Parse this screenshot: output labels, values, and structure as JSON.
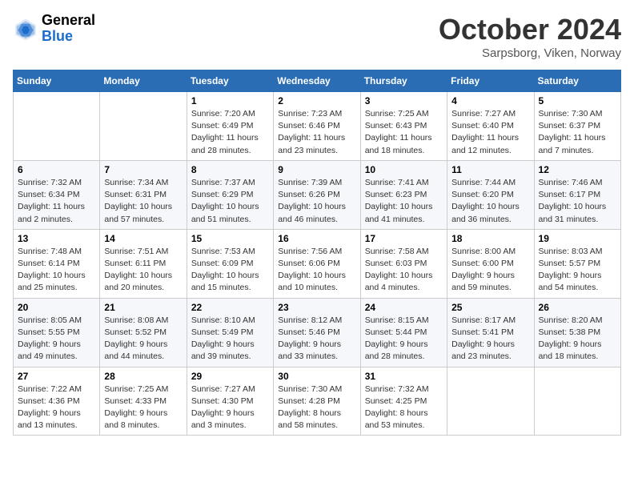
{
  "header": {
    "logo_general": "General",
    "logo_blue": "Blue",
    "month_title": "October 2024",
    "location": "Sarpsborg, Viken, Norway"
  },
  "weekdays": [
    "Sunday",
    "Monday",
    "Tuesday",
    "Wednesday",
    "Thursday",
    "Friday",
    "Saturday"
  ],
  "weeks": [
    [
      {
        "day": "",
        "info": ""
      },
      {
        "day": "",
        "info": ""
      },
      {
        "day": "1",
        "info": "Sunrise: 7:20 AM\nSunset: 6:49 PM\nDaylight: 11 hours and 28 minutes."
      },
      {
        "day": "2",
        "info": "Sunrise: 7:23 AM\nSunset: 6:46 PM\nDaylight: 11 hours and 23 minutes."
      },
      {
        "day": "3",
        "info": "Sunrise: 7:25 AM\nSunset: 6:43 PM\nDaylight: 11 hours and 18 minutes."
      },
      {
        "day": "4",
        "info": "Sunrise: 7:27 AM\nSunset: 6:40 PM\nDaylight: 11 hours and 12 minutes."
      },
      {
        "day": "5",
        "info": "Sunrise: 7:30 AM\nSunset: 6:37 PM\nDaylight: 11 hours and 7 minutes."
      }
    ],
    [
      {
        "day": "6",
        "info": "Sunrise: 7:32 AM\nSunset: 6:34 PM\nDaylight: 11 hours and 2 minutes."
      },
      {
        "day": "7",
        "info": "Sunrise: 7:34 AM\nSunset: 6:31 PM\nDaylight: 10 hours and 57 minutes."
      },
      {
        "day": "8",
        "info": "Sunrise: 7:37 AM\nSunset: 6:29 PM\nDaylight: 10 hours and 51 minutes."
      },
      {
        "day": "9",
        "info": "Sunrise: 7:39 AM\nSunset: 6:26 PM\nDaylight: 10 hours and 46 minutes."
      },
      {
        "day": "10",
        "info": "Sunrise: 7:41 AM\nSunset: 6:23 PM\nDaylight: 10 hours and 41 minutes."
      },
      {
        "day": "11",
        "info": "Sunrise: 7:44 AM\nSunset: 6:20 PM\nDaylight: 10 hours and 36 minutes."
      },
      {
        "day": "12",
        "info": "Sunrise: 7:46 AM\nSunset: 6:17 PM\nDaylight: 10 hours and 31 minutes."
      }
    ],
    [
      {
        "day": "13",
        "info": "Sunrise: 7:48 AM\nSunset: 6:14 PM\nDaylight: 10 hours and 25 minutes."
      },
      {
        "day": "14",
        "info": "Sunrise: 7:51 AM\nSunset: 6:11 PM\nDaylight: 10 hours and 20 minutes."
      },
      {
        "day": "15",
        "info": "Sunrise: 7:53 AM\nSunset: 6:09 PM\nDaylight: 10 hours and 15 minutes."
      },
      {
        "day": "16",
        "info": "Sunrise: 7:56 AM\nSunset: 6:06 PM\nDaylight: 10 hours and 10 minutes."
      },
      {
        "day": "17",
        "info": "Sunrise: 7:58 AM\nSunset: 6:03 PM\nDaylight: 10 hours and 4 minutes."
      },
      {
        "day": "18",
        "info": "Sunrise: 8:00 AM\nSunset: 6:00 PM\nDaylight: 9 hours and 59 minutes."
      },
      {
        "day": "19",
        "info": "Sunrise: 8:03 AM\nSunset: 5:57 PM\nDaylight: 9 hours and 54 minutes."
      }
    ],
    [
      {
        "day": "20",
        "info": "Sunrise: 8:05 AM\nSunset: 5:55 PM\nDaylight: 9 hours and 49 minutes."
      },
      {
        "day": "21",
        "info": "Sunrise: 8:08 AM\nSunset: 5:52 PM\nDaylight: 9 hours and 44 minutes."
      },
      {
        "day": "22",
        "info": "Sunrise: 8:10 AM\nSunset: 5:49 PM\nDaylight: 9 hours and 39 minutes."
      },
      {
        "day": "23",
        "info": "Sunrise: 8:12 AM\nSunset: 5:46 PM\nDaylight: 9 hours and 33 minutes."
      },
      {
        "day": "24",
        "info": "Sunrise: 8:15 AM\nSunset: 5:44 PM\nDaylight: 9 hours and 28 minutes."
      },
      {
        "day": "25",
        "info": "Sunrise: 8:17 AM\nSunset: 5:41 PM\nDaylight: 9 hours and 23 minutes."
      },
      {
        "day": "26",
        "info": "Sunrise: 8:20 AM\nSunset: 5:38 PM\nDaylight: 9 hours and 18 minutes."
      }
    ],
    [
      {
        "day": "27",
        "info": "Sunrise: 7:22 AM\nSunset: 4:36 PM\nDaylight: 9 hours and 13 minutes."
      },
      {
        "day": "28",
        "info": "Sunrise: 7:25 AM\nSunset: 4:33 PM\nDaylight: 9 hours and 8 minutes."
      },
      {
        "day": "29",
        "info": "Sunrise: 7:27 AM\nSunset: 4:30 PM\nDaylight: 9 hours and 3 minutes."
      },
      {
        "day": "30",
        "info": "Sunrise: 7:30 AM\nSunset: 4:28 PM\nDaylight: 8 hours and 58 minutes."
      },
      {
        "day": "31",
        "info": "Sunrise: 7:32 AM\nSunset: 4:25 PM\nDaylight: 8 hours and 53 minutes."
      },
      {
        "day": "",
        "info": ""
      },
      {
        "day": "",
        "info": ""
      }
    ]
  ]
}
